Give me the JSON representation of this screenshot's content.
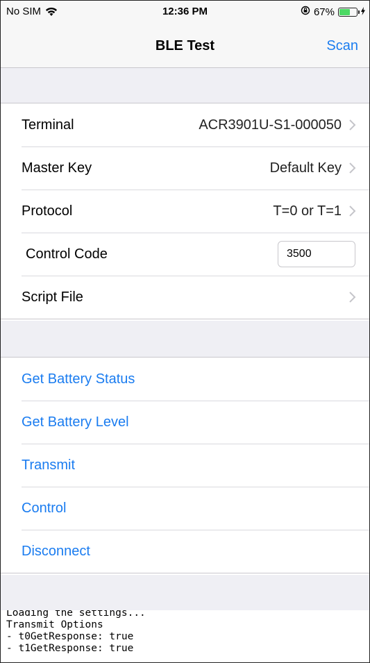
{
  "status_bar": {
    "carrier": "No SIM",
    "time": "12:36 PM",
    "battery_text": "67%",
    "battery_level": 0.67,
    "icons": [
      "wifi-icon",
      "orientation-lock-icon",
      "battery-icon",
      "charging-icon"
    ]
  },
  "nav": {
    "title": "BLE Test",
    "scan_label": "Scan"
  },
  "settings": [
    {
      "label": "Terminal",
      "value": "ACR3901U-S1-000050"
    },
    {
      "label": "Master Key",
      "value": "Default Key"
    },
    {
      "label": "Protocol",
      "value": "T=0 or T=1"
    },
    {
      "label": "Control Code",
      "input_value": "3500"
    },
    {
      "label": "Script File",
      "value": ""
    }
  ],
  "actions": [
    {
      "label": "Get Battery Status"
    },
    {
      "label": "Get Battery Level"
    },
    {
      "label": "Transmit"
    },
    {
      "label": "Control"
    },
    {
      "label": "Disconnect"
    }
  ],
  "log": {
    "lines": [
      "Loading the settings...",
      "Transmit Options",
      "- t0GetResponse: true",
      "- t1GetResponse: true"
    ]
  },
  "colors": {
    "accent": "#1a7cf0",
    "group_background": "#efeff4",
    "battery": "#4cd964"
  }
}
